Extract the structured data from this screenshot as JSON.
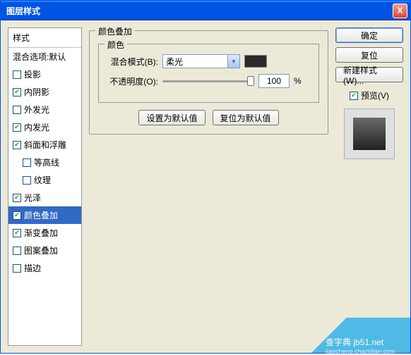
{
  "title": "图层样式",
  "close_icon": "X",
  "left": {
    "header": "样式",
    "option_default": "混合选项:默认",
    "items": [
      {
        "label": "投影",
        "checked": false,
        "indent": false
      },
      {
        "label": "内阴影",
        "checked": true,
        "indent": false
      },
      {
        "label": "外发光",
        "checked": false,
        "indent": false
      },
      {
        "label": "内发光",
        "checked": true,
        "indent": false
      },
      {
        "label": "斜面和浮雕",
        "checked": true,
        "indent": false
      },
      {
        "label": "等高线",
        "checked": false,
        "indent": true
      },
      {
        "label": "纹理",
        "checked": false,
        "indent": true
      },
      {
        "label": "光泽",
        "checked": true,
        "indent": false
      },
      {
        "label": "颜色叠加",
        "checked": true,
        "indent": false,
        "selected": true
      },
      {
        "label": "渐变叠加",
        "checked": true,
        "indent": false
      },
      {
        "label": "图案叠加",
        "checked": false,
        "indent": false
      },
      {
        "label": "描边",
        "checked": false,
        "indent": false
      }
    ]
  },
  "center": {
    "section_title": "颜色叠加",
    "group_title": "颜色",
    "blend_label": "混合模式(B):",
    "blend_value": "柔光",
    "opacity_label": "不透明度(O):",
    "opacity_value": "100",
    "opacity_unit": "%",
    "set_default": "设置为默认值",
    "reset_default": "复位为默认值",
    "color_swatch": "#2a2a2a"
  },
  "right": {
    "ok": "确定",
    "reset": "复位",
    "new_style": "新建样式(W)...",
    "preview_label": "预览(V)",
    "preview_checked": true
  },
  "watermark": {
    "line1": "查字典 jb51.net",
    "line2": "jiaocheng.chazidian.com"
  }
}
